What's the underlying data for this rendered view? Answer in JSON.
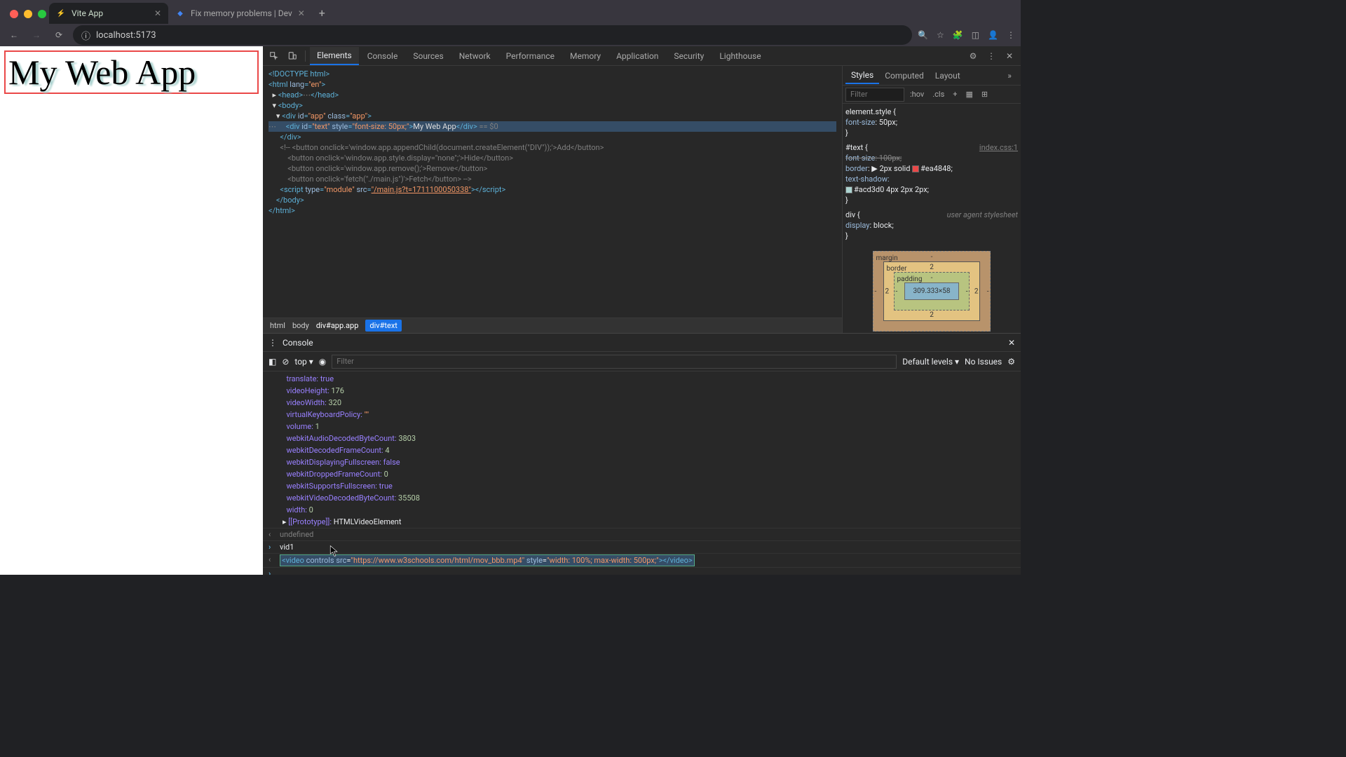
{
  "chrome": {
    "tab1": {
      "title": "Vite App",
      "favicon": "⚡"
    },
    "tab2": {
      "title": "Fix memory problems | Dev",
      "favicon": "◆"
    },
    "url": "localhost:5173"
  },
  "preview": {
    "heading": "My Web App"
  },
  "devtools_tabs": [
    "Elements",
    "Console",
    "Sources",
    "Network",
    "Performance",
    "Memory",
    "Application",
    "Security",
    "Lighthouse"
  ],
  "dom": {
    "l0": "<!DOCTYPE html>",
    "l1_open": "<html",
    "l1_attr1": " lang",
    "l1_val1": "\"en\"",
    "l1_close": ">",
    "l2": "<head>",
    "l2_dots": "⋯",
    "l2_close": "</head>",
    "l3": "<body>",
    "l4_open": "<div",
    "l4_a1": " id",
    "l4_v1": "\"app\"",
    "l4_a2": " class",
    "l4_v2": "\"app\"",
    "l4_close": ">",
    "l5_open": "<div",
    "l5_a1": " id",
    "l5_v1": "\"text\"",
    "l5_a2": " style",
    "l5_v2": "\"font-size: 50px;\"",
    "l5_close": ">",
    "l5_text": "My Web App",
    "l5_endtag": "</div>",
    "l5_suffix": " == $0",
    "l6": "</div>",
    "l7_pre": "<!-- <button onclick='window.app.appendChild(document.createElement(\"DIV\"));'>Add</button>",
    "l8": "    <button onclick='window.app.style.display=\"none\";'>Hide</button>",
    "l9": "    <button onclick='window.app.remove();'>Remove</button>",
    "l10": "    <button onclick='fetch(\"./main.js\")'>Fetch</button> -->",
    "l11_open": "<script",
    "l11_a1": " type",
    "l11_v1": "\"module\"",
    "l11_a2": " src",
    "l11_v2": "\"/main.js?t=1711100050338\"",
    "l11_close": ">",
    "l11_end": "</script>",
    "l12": "</body>",
    "l13": "</html>"
  },
  "breadcrumbs": {
    "b0": "html",
    "b1": "body",
    "b2": "div#app.app",
    "b3": "div#text"
  },
  "styles_tabs": {
    "t0": "Styles",
    "t1": "Computed",
    "t2": "Layout"
  },
  "styles": {
    "filter_ph": "Filter",
    "hov": ":hov",
    "cls": ".cls",
    "r0": "element.style {",
    "r0_p": "  font-size",
    "r0_v": "50px;",
    "r0_end": "}",
    "r1": "#text {",
    "r1_src": "index.css:1",
    "r1_p1": "  font-size",
    "r1_v1": "100px;",
    "r1_p2": "  border",
    "r1_v2a": "▶ 2px solid ",
    "r1_v2b": "#ea4848;",
    "r1_p3": "  text-shadow:",
    "r1_p3b": "     ",
    "r1_v3": "#acd3d0 4px 2px 2px;",
    "r1_end": "}",
    "r2": "div {",
    "r2_src": "user agent stylesheet",
    "r2_p": "  display",
    "r2_v": "block;",
    "r2_end": "}"
  },
  "box_model": {
    "margin": "margin",
    "border": "border",
    "padding": "padding",
    "content": "309.333×58",
    "m": "-",
    "b": "2",
    "p": "-",
    "bl": "2",
    "br": "2",
    "bb": "2",
    "pl": "-",
    "pr": "-"
  },
  "drawer": {
    "title": "Console",
    "context": "top",
    "filter_ph": "Filter",
    "levels": "Default levels",
    "issues": "No Issues"
  },
  "console": {
    "p0k": "translate: ",
    "p0v": "true",
    "p1k": "videoHeight: ",
    "p1v": "176",
    "p2k": "videoWidth: ",
    "p2v": "320",
    "p3k": "virtualKeyboardPolicy: ",
    "p3v": "\"\"",
    "p4k": "volume: ",
    "p4v": "1",
    "p5k": "webkitAudioDecodedByteCount: ",
    "p5v": "3803",
    "p6k": "webkitDecodedFrameCount: ",
    "p6v": "4",
    "p7k": "webkitDisplayingFullscreen: ",
    "p7v": "false",
    "p8k": "webkitDroppedFrameCount: ",
    "p8v": "0",
    "p9k": "webkitSupportsFullscreen: ",
    "p9v": "true",
    "p10k": "webkitVideoDecodedByteCount: ",
    "p10v": "35508",
    "p11k": "width: ",
    "p11v": "0",
    "proto_k": "[[Prototype]]: ",
    "proto_v": "HTMLVideoElement",
    "undef": "undefined",
    "vid": "vid1",
    "last_open": "<video",
    "last_a1": " controls src",
    "last_v1": "\"https://www.w3schools.com/html/mov_bbb.mp4\"",
    "last_a2": " style",
    "last_v2": "\"width: 100%; max-width: 500px;\"",
    "last_close": ">",
    "last_end": "</video>"
  }
}
